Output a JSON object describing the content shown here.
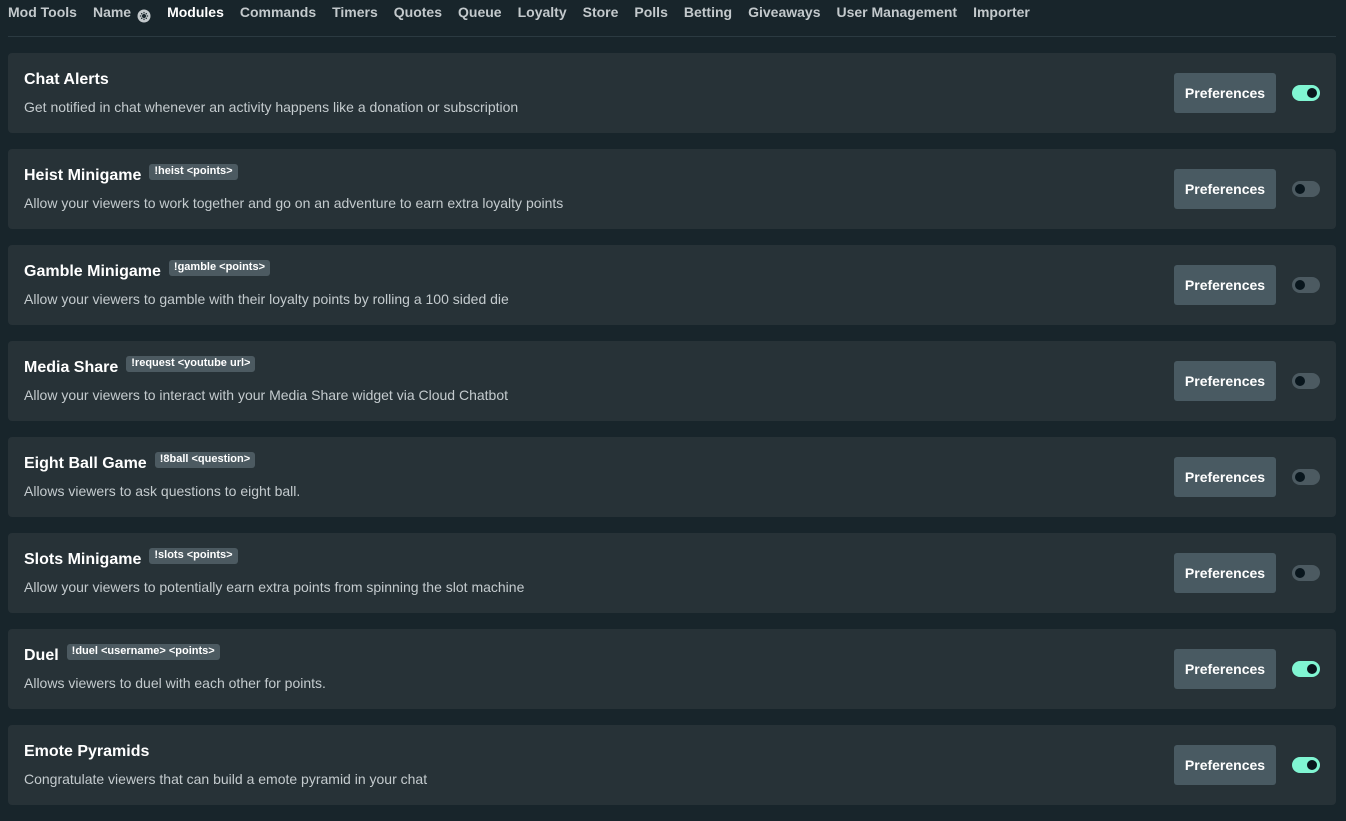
{
  "nav": {
    "tabs": [
      {
        "label": "Mod Tools",
        "active": false
      },
      {
        "label": "Name",
        "active": false,
        "icon": "gear-icon"
      },
      {
        "label": "Modules",
        "active": true
      },
      {
        "label": "Commands",
        "active": false
      },
      {
        "label": "Timers",
        "active": false
      },
      {
        "label": "Quotes",
        "active": false
      },
      {
        "label": "Queue",
        "active": false
      },
      {
        "label": "Loyalty",
        "active": false
      },
      {
        "label": "Store",
        "active": false
      },
      {
        "label": "Polls",
        "active": false
      },
      {
        "label": "Betting",
        "active": false
      },
      {
        "label": "Giveaways",
        "active": false
      },
      {
        "label": "User Management",
        "active": false
      },
      {
        "label": "Importer",
        "active": false
      }
    ]
  },
  "modules": [
    {
      "title": "Chat Alerts",
      "command": "",
      "description": "Get notified in chat whenever an activity happens like a donation or subscription",
      "button": "Preferences",
      "enabled": true
    },
    {
      "title": "Heist Minigame",
      "command": "!heist <points>",
      "description": "Allow your viewers to work together and go on an adventure to earn extra loyalty points",
      "button": "Preferences",
      "enabled": false
    },
    {
      "title": "Gamble Minigame",
      "command": "!gamble <points>",
      "description": "Allow your viewers to gamble with their loyalty points by rolling a 100 sided die",
      "button": "Preferences",
      "enabled": false
    },
    {
      "title": "Media Share",
      "command": "!request <youtube url>",
      "description": "Allow your viewers to interact with your Media Share widget via Cloud Chatbot",
      "button": "Preferences",
      "enabled": false
    },
    {
      "title": "Eight Ball Game",
      "command": "!8ball <question>",
      "description": "Allows viewers to ask questions to eight ball.",
      "button": "Preferences",
      "enabled": false
    },
    {
      "title": "Slots Minigame",
      "command": "!slots <points>",
      "description": "Allow your viewers to potentially earn extra points from spinning the slot machine",
      "button": "Preferences",
      "enabled": false
    },
    {
      "title": "Duel",
      "command": "!duel <username> <points>",
      "description": "Allows viewers to duel with each other for points.",
      "button": "Preferences",
      "enabled": true
    },
    {
      "title": "Emote Pyramids",
      "command": "",
      "description": "Congratulate viewers that can build a emote pyramid in your chat",
      "button": "Preferences",
      "enabled": true
    }
  ],
  "colors": {
    "background": "#18252b",
    "card": "#273237",
    "button": "#495a62",
    "badge": "#4c5a61",
    "toggle_on": "#80f5d2",
    "toggle_off": "#4c5a61"
  }
}
